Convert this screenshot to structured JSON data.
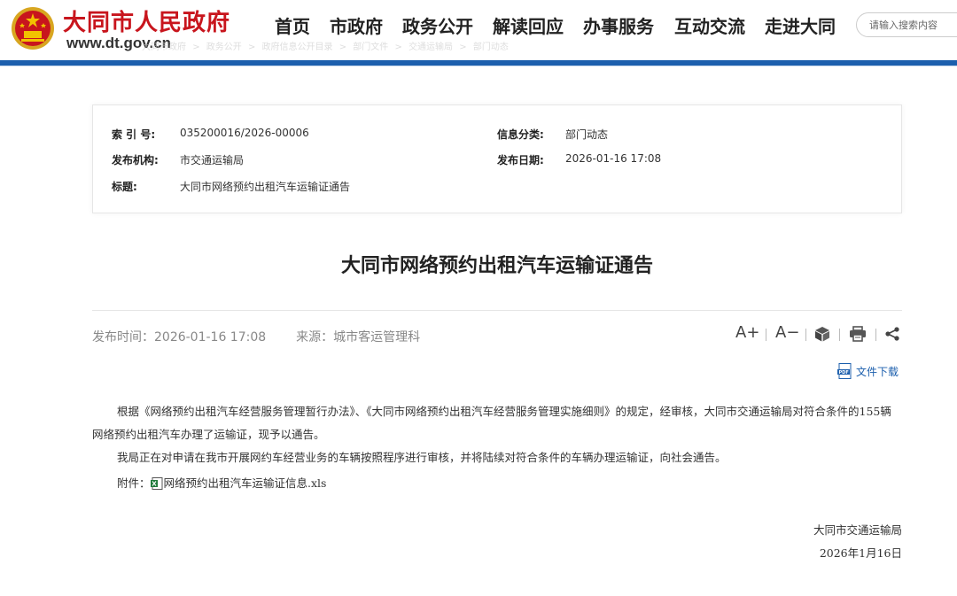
{
  "header": {
    "site_title": "大同市人民政府",
    "site_url": "www.dt.gov.cn",
    "nav": [
      "首页",
      "市政府",
      "政务公开",
      "解读回应",
      "办事服务",
      "互动交流",
      "走进大同"
    ],
    "search_placeholder": "请输入搜索内容",
    "breadcrumb": [
      "大同市政府",
      ">",
      "政务公开",
      ">",
      "政府信息公开目录",
      ">",
      "部门文件",
      ">",
      "交通运输局",
      ">",
      "部门动态"
    ]
  },
  "info": {
    "index_label": "索 引 号:",
    "index_value": "035200016/2026-00006",
    "category_label": "信息分类:",
    "category_value": "部门动态",
    "publisher_label": "发布机构:",
    "publisher_value": "市交通运输局",
    "date_label": "发布日期:",
    "date_value": "2026-01-16 17:08",
    "title_label": "标题:",
    "title_value": "大同市网络预约出租汽车运输证通告"
  },
  "article": {
    "title": "大同市网络预约出租汽车运输证通告",
    "publish_time": "发布时间：2026-01-16 17:08",
    "source": "来源：城市客运管理科",
    "tools": {
      "font_larger": "A+",
      "font_smaller": "A−",
      "print_icon": "print-icon",
      "share_icon": "share-icon",
      "cube_icon": "cube-icon"
    },
    "download_label": "文件下载",
    "paragraph1": "根据《网络预约出租汽车经营服务管理暂行办法》、《大同市网络预约出租汽车经营服务管理实施细则》的规定，经审核，大同市交通运输局对符合条件的155辆网络预约出租汽车办理了运输证，现予以通告。",
    "paragraph2": "我局正在对申请在我市开展网约车经营业务的车辆按照程序进行审核，并将陆续对符合条件的车辆办理运输证，向社会通告。",
    "attachment_label": "附件：",
    "attachment_file": "网络预约出租汽车运输证信息.xls",
    "signature_org": "大同市交通运输局",
    "signature_date": "2026年1月16日"
  },
  "colors": {
    "brand_red": "#c8151d",
    "brand_blue": "#1c5fad",
    "title_gold": "#e0b400"
  }
}
